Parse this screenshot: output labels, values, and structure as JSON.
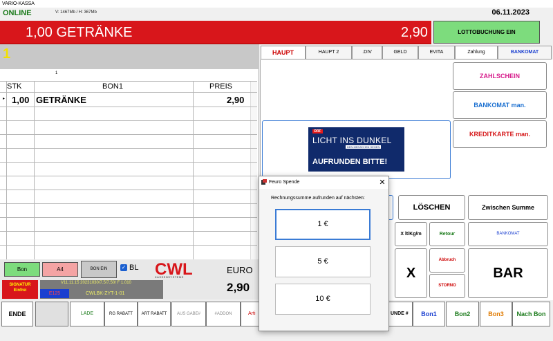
{
  "window": {
    "title": "VARIO-KASSA",
    "status": "ONLINE",
    "memory": "V: 1467Mb / H: 367Mb",
    "date": "06.11.2023"
  },
  "header": {
    "item": "1,00 GETRÄNKE",
    "price": "2,90",
    "lotto_button": "LOTTOBUCHUNG EIN"
  },
  "receipt": {
    "table_number": "1",
    "column_number": "1",
    "columns": [
      "STK",
      "BON1",
      "PREIS"
    ],
    "rows": [
      {
        "qty": "1,00",
        "name": "GETRÄNKE",
        "price": "2,90",
        "marker": "▸"
      }
    ]
  },
  "left_controls": {
    "bon": "Bon",
    "a4": "A4",
    "bon_ein": "BON EIN",
    "bl_checkbox": "BL",
    "bl_checked": true,
    "bl_check_glyph": "✓",
    "logo_text": "CWL",
    "logo_subtitle": "KASSENSYSTEME",
    "currency": "EURO",
    "total": "2,90",
    "signatur": "SIGNATUR",
    "signatur_sub": "Einfrei",
    "error_code": "E125",
    "version": "V11.11.15 20231030/7.5/7.50/ F 1.010",
    "cwl_code": "CWLBK-ZYT-1-01"
  },
  "bottom_bar": {
    "ende": "ENDE",
    "lade": "LADE",
    "rg_rabatt": "RG RABATT",
    "art_rabatt": "ART RABATT",
    "ausgabe": "AUS GABE#",
    "addon": "#ADDON",
    "arti": "Arti",
    "unde": "UNDE #",
    "bon1": "Bon1",
    "bon2": "Bon2",
    "bon3": "Bon3",
    "nachbon": "Nach Bon"
  },
  "tabs": [
    {
      "label": "HAUPT",
      "active": true
    },
    {
      "label": "HAUPT 2"
    },
    {
      "label": ".DIV"
    },
    {
      "label": "GELD"
    },
    {
      "label": "EVITA"
    },
    {
      "label": "Zahlung"
    },
    {
      "label": "BANKOMAT"
    }
  ],
  "payment": {
    "zahlschein": "ZAHLSCHEIN",
    "bankomat_man": "BANKOMAT man.",
    "kreditkarte_man": "KREDITKARTE man.",
    "banner_orf": "ORF",
    "banner_title": "LICHT INS DUNKEL",
    "banner_tagline": "DEN MENSCHEN SEHEN",
    "banner_cta": "AUFRUNDEN BITTE!",
    "loeschen": "LÖSCHEN",
    "zwischen_summe": "Zwischen Summe",
    "x_lt": "X lt/Kg/m",
    "retour": "Retour",
    "bankomat": "BANKOMAT",
    "x": "X",
    "abbruch": "Abbruch",
    "storno": "STORNO",
    "bar": "BAR"
  },
  "dialog": {
    "title": "Feuro Spende",
    "close": "✕",
    "prompt": "Rechnungssumme aufrunden auf nächsten:",
    "options": [
      "1 €",
      "5 €",
      "10 €"
    ]
  },
  "colors": {
    "red_bar": "#d8161b",
    "lotto_green": "#7ddc7d",
    "accent_blue": "#3a7bd5"
  }
}
